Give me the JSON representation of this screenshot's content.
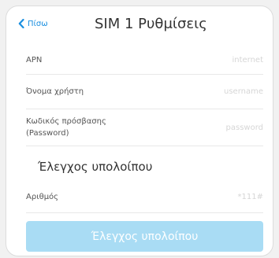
{
  "header": {
    "back_label": "Πίσω",
    "title": "SIM 1 Ρυθμίσεις"
  },
  "fields": [
    {
      "label": "APN",
      "placeholder": "internet"
    },
    {
      "label": "Όνομα χρήστη",
      "placeholder": "username"
    },
    {
      "label": "Κωδικός πρόσβασης (Password)",
      "placeholder": "password"
    }
  ],
  "balance": {
    "section_title": "Έλεγχος υπολοίπου",
    "number_label": "Αριθμός",
    "number_placeholder": "*111#",
    "button_label": "Έλεγχος υπολοίπου"
  },
  "colors": {
    "accent": "#1a8fe0",
    "button_disabled": "#a9dcf4"
  },
  "icons": {
    "back": "chevron-left-icon"
  }
}
